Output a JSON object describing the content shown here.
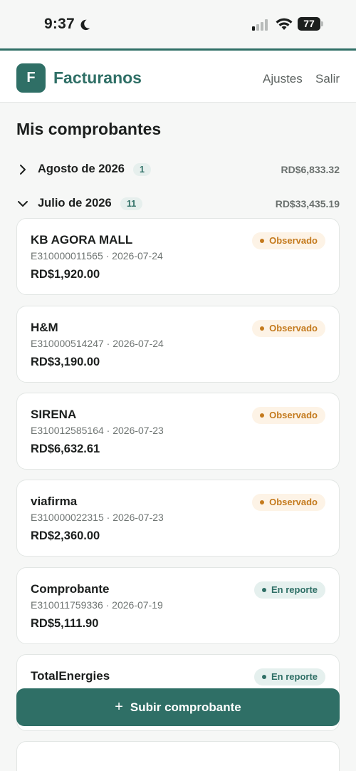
{
  "status": {
    "time": "9:37",
    "battery": "77"
  },
  "header": {
    "logo_letter": "F",
    "brand": "Facturanos",
    "nav_settings": "Ajustes",
    "nav_logout": "Salir"
  },
  "page": {
    "title": "Mis comprobantes"
  },
  "groups": [
    {
      "label": "Agosto de 2026",
      "count": "1",
      "total": "RD$6,833.32",
      "expanded": false
    },
    {
      "label": "Julio de 2026",
      "count": "11",
      "total": "RD$33,435.19",
      "expanded": true
    }
  ],
  "receipts": [
    {
      "name": "KB AGORA MALL",
      "meta": "E310000011565 · 2026-07-24",
      "amount": "RD$1,920.00",
      "status": "Observado"
    },
    {
      "name": "H&M",
      "meta": "E310000514247 · 2026-07-24",
      "amount": "RD$3,190.00",
      "status": "Observado"
    },
    {
      "name": "SIRENA",
      "meta": "E310012585164 · 2026-07-23",
      "amount": "RD$6,632.61",
      "status": "Observado"
    },
    {
      "name": "viafirma",
      "meta": "E310000022315 · 2026-07-23",
      "amount": "RD$2,360.00",
      "status": "Observado"
    },
    {
      "name": "Comprobante",
      "meta": "E310011759336 · 2026-07-19",
      "amount": "RD$5,111.90",
      "status": "En reporte"
    },
    {
      "name": "TotalEnergies",
      "meta": "",
      "amount": "",
      "status": "En reporte"
    }
  ],
  "actions": {
    "upload": "Subir comprobante"
  },
  "colors": {
    "primary": "#2f6f66",
    "observed": "#c47a1d",
    "reported": "#2f6f66"
  }
}
